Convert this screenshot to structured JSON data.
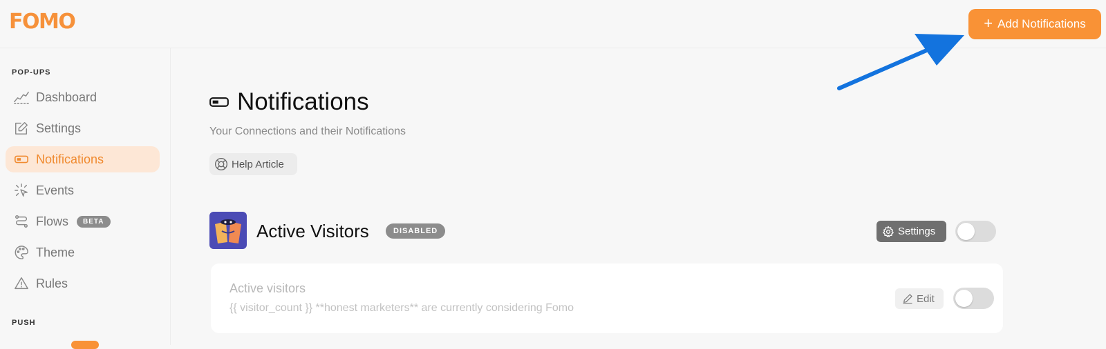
{
  "brand": {
    "logo_text": "FOMO",
    "accent_color": "#f99236"
  },
  "header": {
    "add_button_label": "Add Notifications",
    "add_button_icon": "plus-icon"
  },
  "sidebar": {
    "sections": [
      {
        "label": "POP-UPS",
        "items": [
          {
            "label": "Dashboard",
            "icon": "trend-line-icon",
            "active": false
          },
          {
            "label": "Settings",
            "icon": "edit-square-icon",
            "active": false
          },
          {
            "label": "Notifications",
            "icon": "toggle-icon",
            "active": true
          },
          {
            "label": "Events",
            "icon": "click-sparkle-icon",
            "active": false
          },
          {
            "label": "Flows",
            "icon": "flow-icon",
            "active": false,
            "badge": "BETA"
          },
          {
            "label": "Theme",
            "icon": "palette-icon",
            "active": false
          },
          {
            "label": "Rules",
            "icon": "warning-triangle-icon",
            "active": false
          }
        ]
      },
      {
        "label": "PUSH",
        "items": []
      }
    ]
  },
  "main": {
    "title": "Notifications",
    "subtitle": "Your Connections and their Notifications",
    "help_button": "Help Article",
    "connection": {
      "name": "Active Visitors",
      "status": "DISABLED",
      "settings_label": "Settings",
      "enabled": false,
      "notifications": [
        {
          "title": "Active visitors",
          "message": "{{ visitor_count }} **honest marketers** are currently considering Fomo",
          "edit_label": "Edit",
          "enabled": false
        }
      ]
    }
  }
}
